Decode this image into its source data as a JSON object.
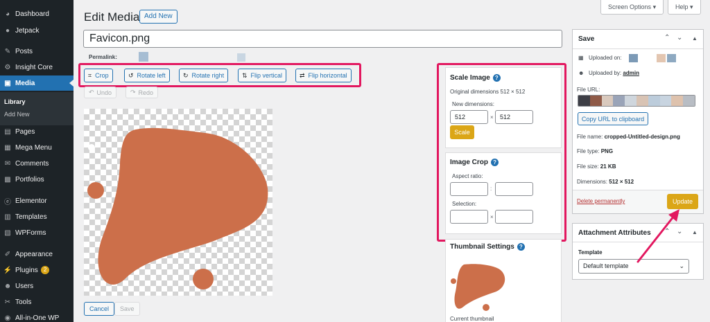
{
  "sidebar": {
    "items": [
      {
        "label": "Dashboard",
        "icon": "dashboard-icon",
        "glyph": "◕"
      },
      {
        "label": "Jetpack",
        "icon": "jetpack-icon",
        "glyph": "●"
      },
      {
        "label": "Posts",
        "icon": "pin-icon",
        "glyph": "✎"
      },
      {
        "label": "Insight Core",
        "icon": "insight-icon",
        "glyph": "⚙"
      },
      {
        "label": "Media",
        "icon": "media-icon",
        "glyph": "▣"
      },
      {
        "label": "Pages",
        "icon": "pages-icon",
        "glyph": "▤"
      },
      {
        "label": "Mega Menu",
        "icon": "mega-menu-icon",
        "glyph": "▦"
      },
      {
        "label": "Comments",
        "icon": "comments-icon",
        "glyph": "✉"
      },
      {
        "label": "Portfolios",
        "icon": "portfolios-icon",
        "glyph": "▩"
      },
      {
        "label": "Elementor",
        "icon": "elementor-icon",
        "glyph": "ⓔ"
      },
      {
        "label": "Templates",
        "icon": "templates-icon",
        "glyph": "▥"
      },
      {
        "label": "WPForms",
        "icon": "wpforms-icon",
        "glyph": "▧"
      },
      {
        "label": "Appearance",
        "icon": "appearance-icon",
        "glyph": "✐"
      },
      {
        "label": "Plugins",
        "icon": "plugins-icon",
        "glyph": "⚡",
        "badge": "2"
      },
      {
        "label": "Users",
        "icon": "users-icon",
        "glyph": "☻"
      },
      {
        "label": "Tools",
        "icon": "tools-icon",
        "glyph": "✂"
      },
      {
        "label": "All-in-One WP",
        "icon": "aio-icon",
        "glyph": "◉"
      }
    ],
    "media_sub": [
      "Library",
      "Add New"
    ]
  },
  "header": {
    "title": "Edit Media",
    "add_new": "Add New",
    "screen_options": "Screen Options",
    "help": "Help"
  },
  "title_value": "Favicon.png",
  "permalink_label": "Permalink:",
  "toolbar": {
    "crop": "Crop",
    "rotate_left": "Rotate left",
    "rotate_right": "Rotate right",
    "flip_vertical": "Flip vertical",
    "flip_horizontal": "Flip horizontal",
    "undo": "Undo",
    "redo": "Redo"
  },
  "actions": {
    "cancel": "Cancel",
    "save": "Save"
  },
  "scale": {
    "title": "Scale Image",
    "original": "Original dimensions 512 × 512",
    "new_dims": "New dimensions:",
    "width": "512",
    "height": "512",
    "times": "×",
    "button": "Scale"
  },
  "crop": {
    "title": "Image Crop",
    "aspect": "Aspect ratio:",
    "colon": ":",
    "selection": "Selection:",
    "times": "×"
  },
  "thumb": {
    "title": "Thumbnail Settings",
    "current": "Current thumbnail"
  },
  "save_box": {
    "title": "Save",
    "uploaded_on": "Uploaded on:",
    "uploaded_by": "Uploaded by:",
    "author": "admin",
    "file_url": "File URL:",
    "copy": "Copy URL to clipboard",
    "file_name_label": "File name:",
    "file_name": "cropped-Untitled-design.png",
    "file_type_label": "File type:",
    "file_type": "PNG",
    "file_size_label": "File size:",
    "file_size": "21 KB",
    "dimensions_label": "Dimensions:",
    "dimensions": "512 × 512",
    "delete": "Delete permanently",
    "update": "Update"
  },
  "attach_box": {
    "title": "Attachment Attributes",
    "template_label": "Template",
    "template_value": "Default template"
  },
  "colors": {
    "accent": "#2271b1",
    "highlight": "#e2175f",
    "blob": "#cc6f4a",
    "button_warn": "#dba617"
  }
}
